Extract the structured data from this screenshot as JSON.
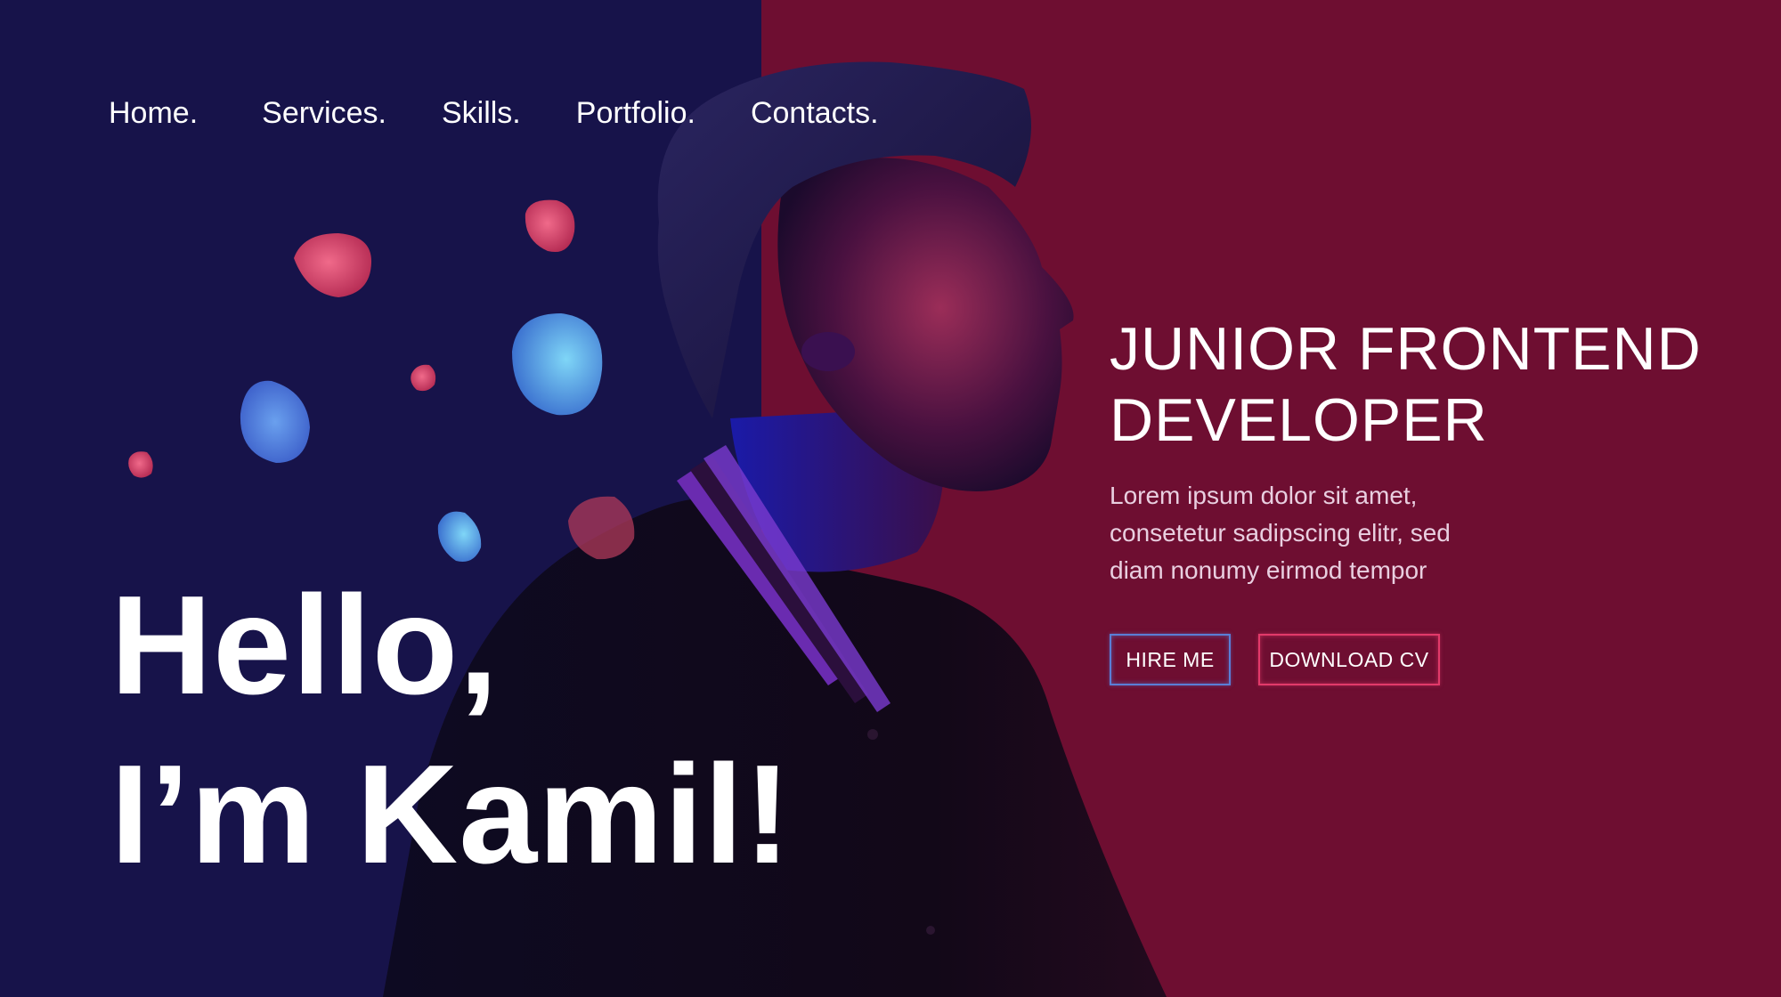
{
  "nav": {
    "items": [
      {
        "label": "Home."
      },
      {
        "label": "Services."
      },
      {
        "label": "Skills."
      },
      {
        "label": "Portfolio."
      },
      {
        "label": "Contacts."
      }
    ]
  },
  "hero": {
    "greeting_line1": "Hello,",
    "greeting_line2": "I’m Kamil!",
    "role_line1": "JUNIOR FRONTEND",
    "role_line2": "DEVELOPER",
    "description_lines": [
      "Lorem ipsum dolor sit amet,",
      "consetetur sadipscing elitr, sed",
      "diam nonumy eirmod tempor"
    ],
    "hire_button": "HIRE ME",
    "cv_button": "DOWNLOAD CV"
  },
  "colors": {
    "left_background": "#17134a",
    "right_background": "#6e0e31",
    "blob_red": "#e05576",
    "blob_blue": "#5aa8ea",
    "hire_border": "#5a7ed6",
    "cv_border": "#e23a6a"
  },
  "icons": {
    "decorative_shapes": "floating-blobs"
  }
}
